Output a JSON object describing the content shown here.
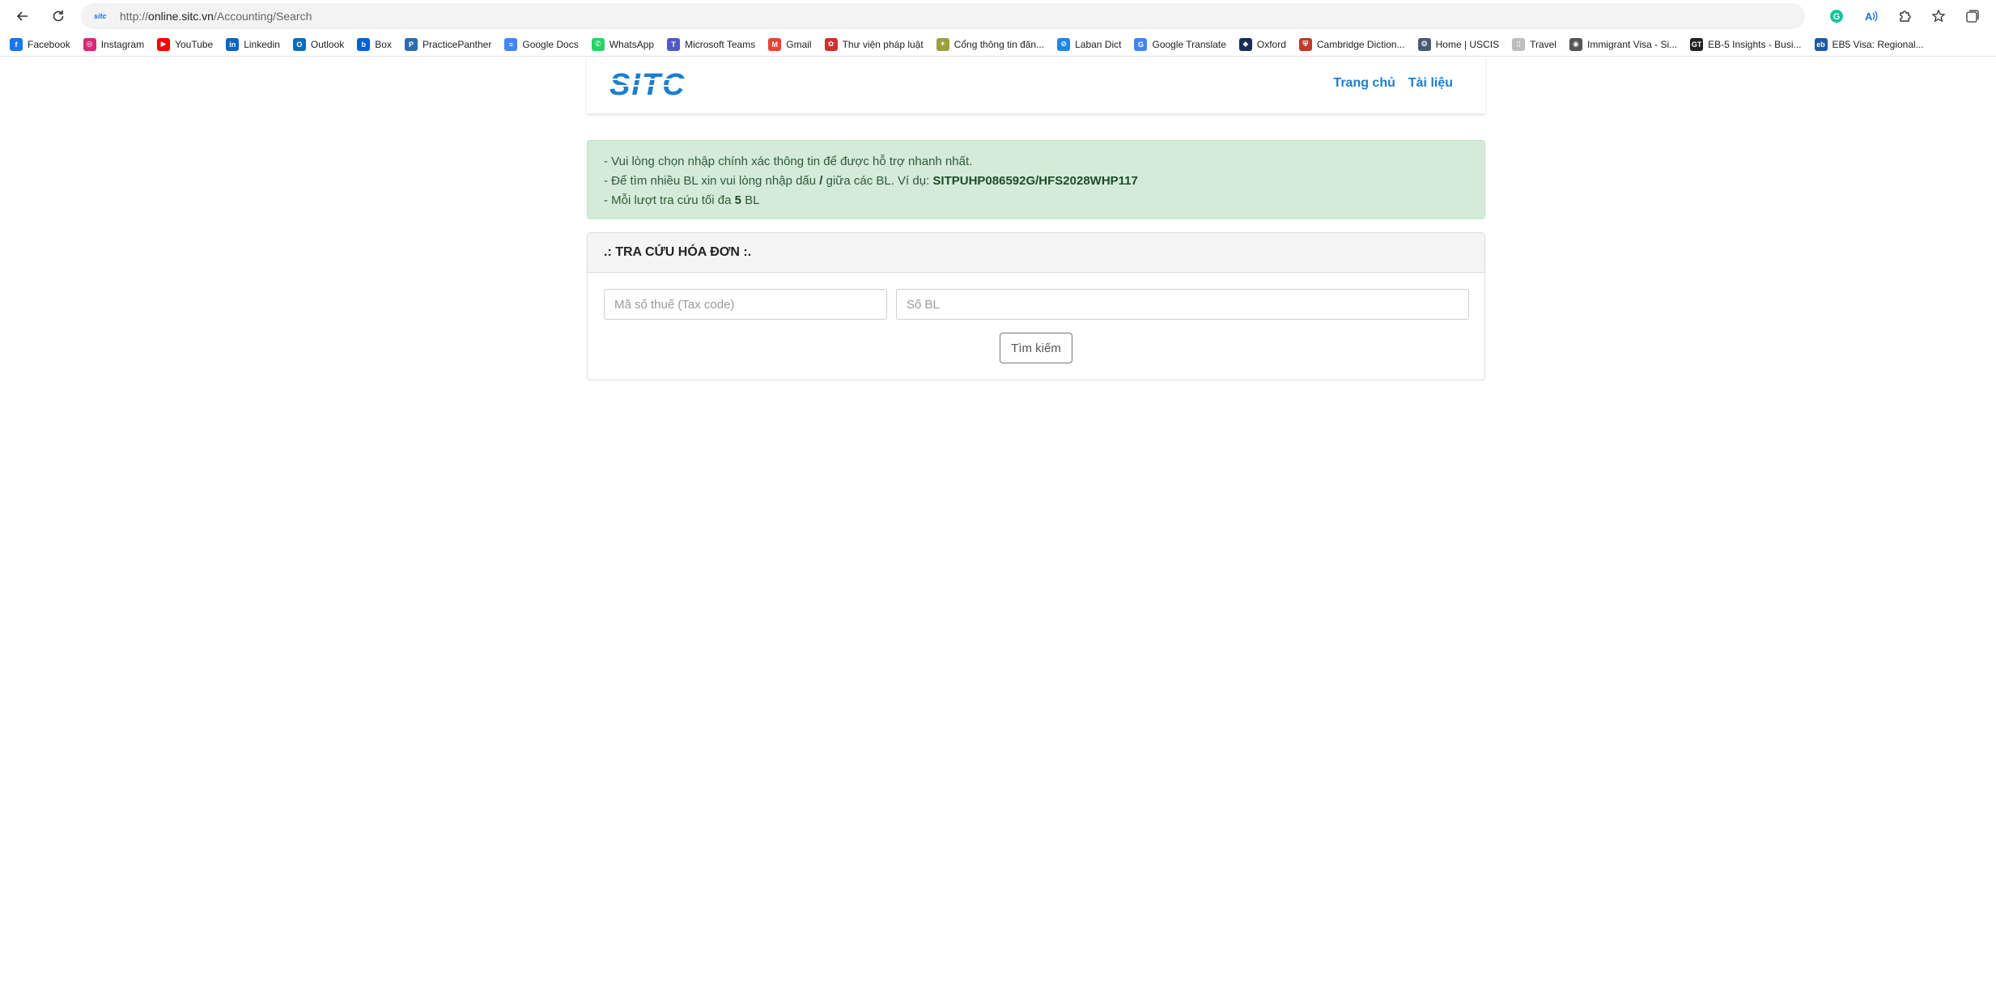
{
  "browser": {
    "url_scheme": "http://",
    "url_host": "online.sitc.vn",
    "url_path": "/Accounting/Search",
    "favicon_text": "sitc",
    "bookmarks": [
      {
        "label": "Facebook",
        "icon": "facebook-icon",
        "color": "#1877f2",
        "glyph": "f"
      },
      {
        "label": "Instagram",
        "icon": "instagram-icon",
        "color": "#d62976",
        "glyph": "◎"
      },
      {
        "label": "YouTube",
        "icon": "youtube-icon",
        "color": "#ff0000",
        "glyph": "▶"
      },
      {
        "label": "Linkedin",
        "icon": "linkedin-icon",
        "color": "#0a66c2",
        "glyph": "in"
      },
      {
        "label": "Outlook",
        "icon": "outlook-icon",
        "color": "#0f6cbd",
        "glyph": "O"
      },
      {
        "label": "Box",
        "icon": "box-icon",
        "color": "#0061d5",
        "glyph": "b"
      },
      {
        "label": "PracticePanther",
        "icon": "practicepanther-icon",
        "color": "#2b6cb0",
        "glyph": "P"
      },
      {
        "label": "Google Docs",
        "icon": "google-docs-icon",
        "color": "#4285f4",
        "glyph": "≡"
      },
      {
        "label": "WhatsApp",
        "icon": "whatsapp-icon",
        "color": "#25d366",
        "glyph": "✆"
      },
      {
        "label": "Microsoft Teams",
        "icon": "teams-icon",
        "color": "#5059c9",
        "glyph": "T"
      },
      {
        "label": "Gmail",
        "icon": "gmail-icon",
        "color": "#ea4335",
        "glyph": "M"
      },
      {
        "label": "Thư viện pháp luật",
        "icon": "thuvienphapluat-icon",
        "color": "#d32f2f",
        "glyph": "✿"
      },
      {
        "label": "Cổng thông tin đăn...",
        "icon": "portal-icon",
        "color": "#9aa13a",
        "glyph": "✦"
      },
      {
        "label": "Laban Dict",
        "icon": "laban-icon",
        "color": "#1e88e5",
        "glyph": "⊘"
      },
      {
        "label": "Google Translate",
        "icon": "translate-icon",
        "color": "#4285f4",
        "glyph": "G"
      },
      {
        "label": "Oxford",
        "icon": "oxford-icon",
        "color": "#1a2b5c",
        "glyph": "◆"
      },
      {
        "label": "Cambridge Diction...",
        "icon": "cambridge-icon",
        "color": "#c0392b",
        "glyph": "⛨"
      },
      {
        "label": "Home | USCIS",
        "icon": "uscis-icon",
        "color": "#4a5a70",
        "glyph": "❂"
      },
      {
        "label": "Travel",
        "icon": "travel-icon",
        "color": "#bdbdbd",
        "glyph": "▯"
      },
      {
        "label": "Immigrant Visa - Si...",
        "icon": "immigrant-visa-icon",
        "color": "#555555",
        "glyph": "◉"
      },
      {
        "label": "EB-5 Insights - Busi...",
        "icon": "eb5-insights-icon",
        "color": "#222222",
        "glyph": "GT"
      },
      {
        "label": "EB5 Visa: Regional...",
        "icon": "eb5-visa-icon",
        "color": "#1e5aa8",
        "glyph": "eb"
      }
    ]
  },
  "header": {
    "logo_text": "SITC",
    "nav": {
      "home": "Trang chủ",
      "docs": "Tài liệu"
    },
    "brand_color": "#1b7fce"
  },
  "notice": {
    "line1": "- Vui lòng chọn nhập chính xác thông tin để được hỗ trợ nhanh nhất.",
    "line2_prefix": "- Để tìm nhiều BL xin vui lòng nhập dấu ",
    "line2_sep": "/",
    "line2_mid": " giữa các BL. Ví dụ: ",
    "line2_example": "SITPUHP086592G/HFS2028WHP117",
    "line3_prefix": "- Mỗi lượt tra cứu tối đa ",
    "line3_count": "5",
    "line3_suffix": " BL"
  },
  "search": {
    "title": ".: TRA CỨU HÓA ĐƠN :.",
    "tax_placeholder": "Mã số thuế (Tax code)",
    "bl_placeholder": "Số BL",
    "button_label": "Tìm kiếm"
  }
}
